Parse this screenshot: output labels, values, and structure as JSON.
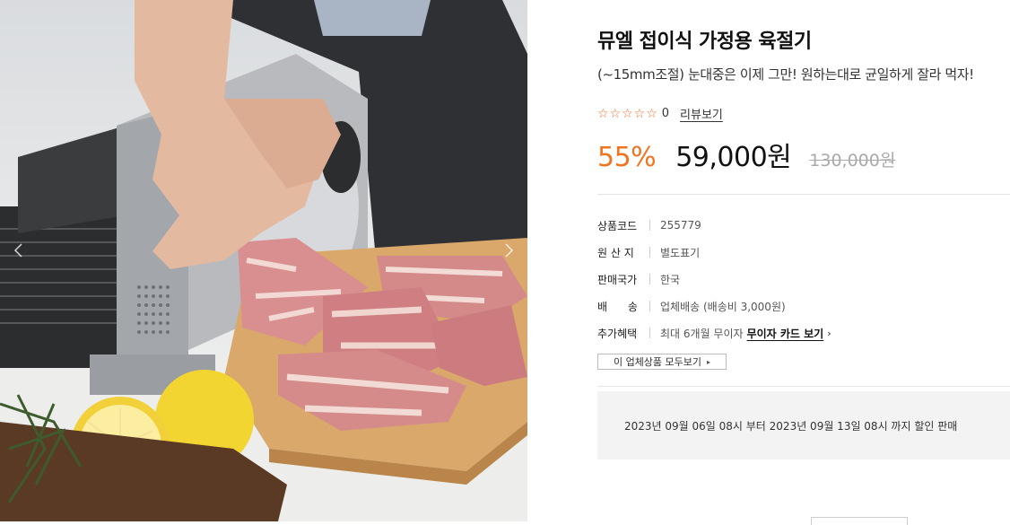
{
  "product": {
    "title": "뮤엘 접이식 가정용 육절기",
    "subtitle": "(~15mm조절) 눈대중은 이제 그만! 원하는대로 균일하게 잘라 먹자!",
    "rating": {
      "stars": "☆☆☆☆☆",
      "count": "0",
      "review_link": "리뷰보기"
    },
    "discount": "55%",
    "sale_price": "59,000원",
    "original_price": "130,000원"
  },
  "specs": {
    "code": {
      "label": "상품코드",
      "value": "255779"
    },
    "origin": {
      "label": "원 산 지",
      "value": "별도표기"
    },
    "country": {
      "label": "판매국가",
      "value": "한국"
    },
    "shipping": {
      "label": "배      송",
      "value": "업체배송 (배송비 3,000원)"
    },
    "benefit": {
      "label": "추가혜택",
      "value": "최대 6개월 무이자",
      "link": "무이자 카드 보기",
      "arrow": "›"
    }
  },
  "vendor_button": {
    "label": "이 업체상품 모두보기",
    "chevron": "▸"
  },
  "sale_period": "2023년 09월 06일 08시 부터 2023년 09월 13일 08시 까지 할인 판매",
  "icons": {
    "gallery_prev": "chevron-left-icon",
    "gallery_next": "chevron-right-icon",
    "star": "star-outline-icon"
  },
  "colors": {
    "accent": "#f0741f",
    "star": "#f26b2a"
  }
}
